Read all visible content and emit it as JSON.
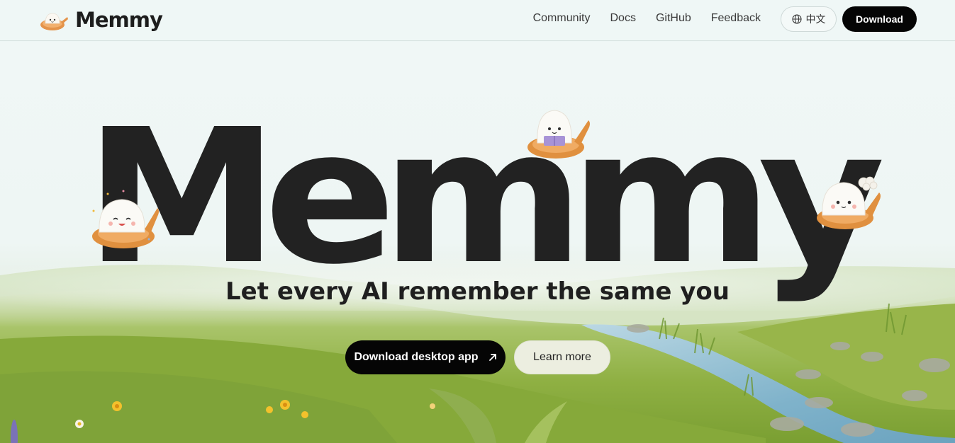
{
  "nav": {
    "brand": "Memmy",
    "links": [
      "Community",
      "Docs",
      "GitHub",
      "Feedback"
    ],
    "language": "中文",
    "download": "Download"
  },
  "hero": {
    "title": "Memmy",
    "subtitle": "Let every AI remember the same you",
    "primary_cta": "Download desktop app",
    "secondary_cta": "Learn more"
  },
  "icons": {
    "logo": "memmy-mascot-logo",
    "language": "globe-icon",
    "cta_arrow": "arrow-up-right-icon"
  },
  "colors": {
    "background": "#eef6f5",
    "text": "#222222",
    "button_dark": "#050505",
    "button_light": "#eceee0",
    "spoon": "#e79a4b"
  }
}
